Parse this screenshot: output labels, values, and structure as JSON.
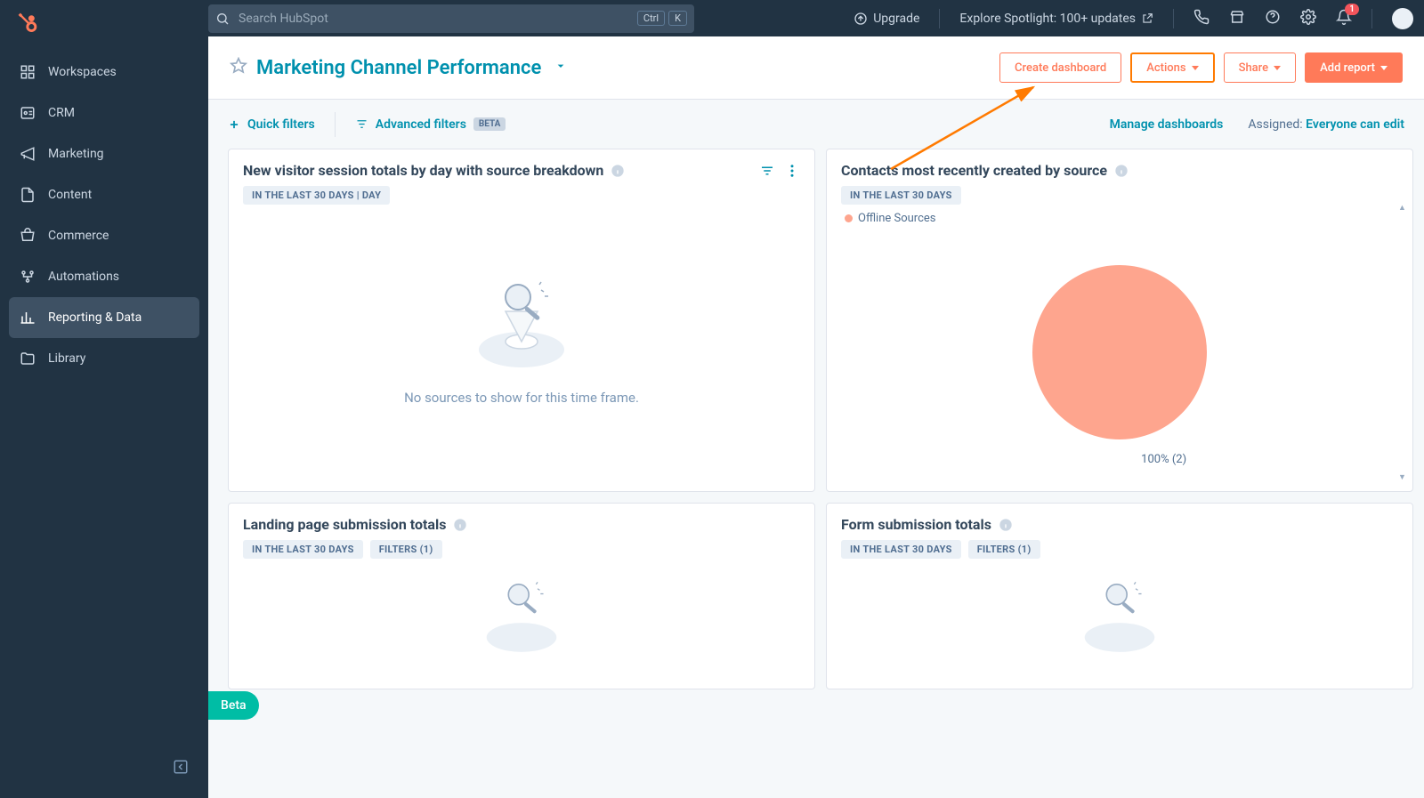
{
  "brand_color": "#ff7a59",
  "sidebar": {
    "items": [
      {
        "label": "Workspaces"
      },
      {
        "label": "CRM"
      },
      {
        "label": "Marketing"
      },
      {
        "label": "Content"
      },
      {
        "label": "Commerce"
      },
      {
        "label": "Automations"
      },
      {
        "label": "Reporting & Data"
      },
      {
        "label": "Library"
      }
    ]
  },
  "topbar": {
    "search_placeholder": "Search HubSpot",
    "kbd1": "Ctrl",
    "kbd2": "K",
    "upgrade": "Upgrade",
    "spotlight": "Explore Spotlight: 100+ updates",
    "notif_count": "1"
  },
  "header": {
    "title": "Marketing Channel Performance",
    "create_dashboard": "Create dashboard",
    "actions": "Actions",
    "share": "Share",
    "add_report": "Add report"
  },
  "filters": {
    "quick": "Quick filters",
    "advanced": "Advanced filters",
    "beta": "BETA",
    "manage": "Manage dashboards",
    "assigned_label": "Assigned:",
    "assigned_value": "Everyone can edit"
  },
  "cards": [
    {
      "title": "New visitor session totals by day with source breakdown",
      "pills": [
        "IN THE LAST 30 DAYS | DAY"
      ],
      "empty": "No sources to show for this time frame."
    },
    {
      "title": "Contacts most recently created by source",
      "pills": [
        "IN THE LAST 30 DAYS"
      ],
      "legend": "Offline Sources",
      "pie_label": "100% (2)"
    },
    {
      "title": "Landing page submission totals",
      "pills": [
        "IN THE LAST 30 DAYS",
        "FILTERS (1)"
      ]
    },
    {
      "title": "Form submission totals",
      "pills": [
        "IN THE LAST 30 DAYS",
        "FILTERS (1)"
      ]
    }
  ],
  "beta_float": "Beta",
  "chart_data": {
    "type": "pie",
    "title": "Contacts most recently created by source",
    "series": [
      {
        "name": "Offline Sources",
        "value": 2,
        "percent": 100,
        "color": "#fea58e"
      }
    ]
  }
}
